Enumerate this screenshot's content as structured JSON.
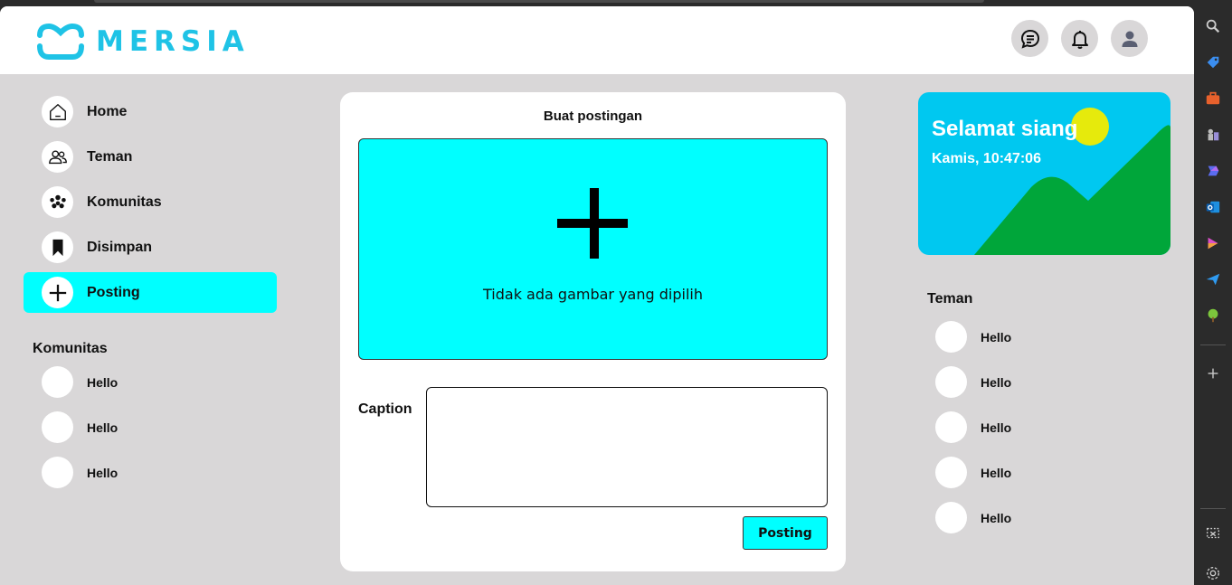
{
  "app": {
    "brand": "MERSIA",
    "brand_color": "#1fc3e6",
    "accent_color": "#00ffff",
    "background_color": "#d9d7d8"
  },
  "header": {
    "icons": [
      "chat-icon",
      "bell-icon",
      "user-icon"
    ]
  },
  "sidebar": {
    "nav": [
      {
        "label": "Home",
        "icon": "home-icon"
      },
      {
        "label": "Teman",
        "icon": "friends-icon"
      },
      {
        "label": "Komunitas",
        "icon": "community-icon"
      },
      {
        "label": "Disimpan",
        "icon": "bookmark-icon"
      },
      {
        "label": "Posting",
        "icon": "plus-icon",
        "active": true
      }
    ],
    "communities_title": "Komunitas",
    "communities": [
      {
        "label": "Hello"
      },
      {
        "label": "Hello"
      },
      {
        "label": "Hello"
      }
    ]
  },
  "post": {
    "title": "Buat postingan",
    "no_image_text": "Tidak ada gambar yang dipilih",
    "caption_label": "Caption",
    "caption_value": "",
    "submit_label": "Posting"
  },
  "weather": {
    "greeting": "Selamat siang",
    "datetime": "Kamis, 10:47:06"
  },
  "friends": {
    "title": "Teman",
    "items": [
      {
        "label": "Hello"
      },
      {
        "label": "Hello"
      },
      {
        "label": "Hello"
      },
      {
        "label": "Hello"
      },
      {
        "label": "Hello"
      }
    ]
  },
  "browser_sidebar": {
    "icons": [
      "search-icon",
      "tag-icon",
      "briefcase-icon",
      "chess-icon",
      "copilot-icon",
      "outlook-icon",
      "designer-icon",
      "send-icon",
      "tree-icon",
      "add-icon",
      "screenshot-icon",
      "settings-icon"
    ]
  }
}
